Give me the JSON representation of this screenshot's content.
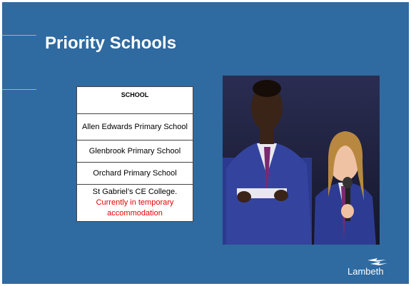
{
  "slide": {
    "title": "Priority Schools",
    "accent_color": "#e8a33a",
    "background_color": "#2f6aa0"
  },
  "table": {
    "header": "SCHOOL",
    "rows": [
      {
        "name": "Allen Edwards Primary School",
        "note": ""
      },
      {
        "name": "Glenbrook Primary School",
        "note": ""
      },
      {
        "name": "Orchard Primary School",
        "note": ""
      },
      {
        "name": "St Gabriel’s CE College.",
        "note": "Currently in temporary accommodation"
      }
    ],
    "note_color": "#e10000"
  },
  "logo": {
    "text": "Lambeth"
  },
  "photo": {
    "icon": "students-speaking-photo"
  }
}
